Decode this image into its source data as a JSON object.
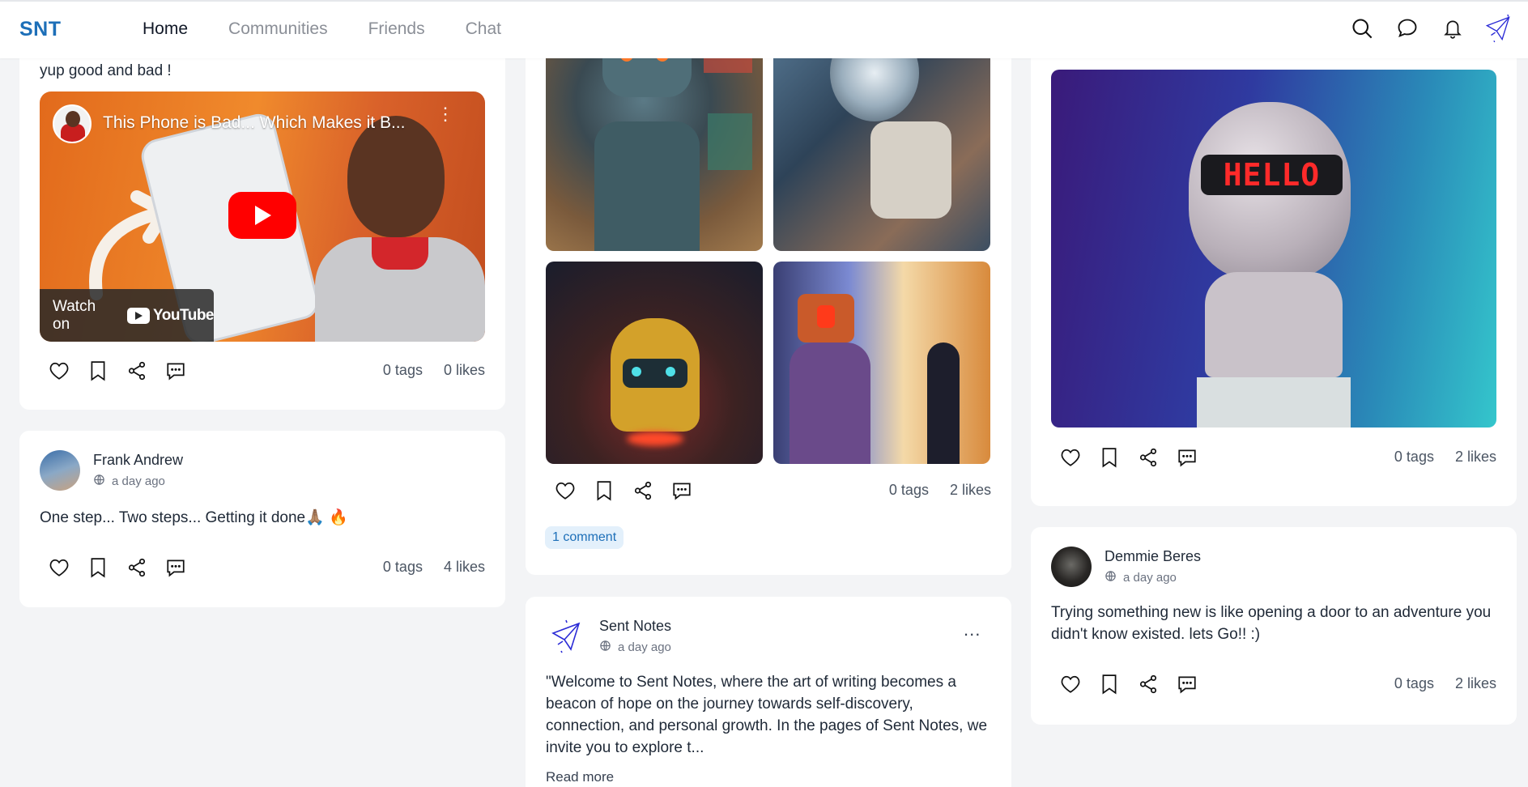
{
  "nav": {
    "logo": "SNT",
    "links": [
      {
        "label": "Home",
        "active": true
      },
      {
        "label": "Communities",
        "active": false
      },
      {
        "label": "Friends",
        "active": false
      },
      {
        "label": "Chat",
        "active": false
      }
    ],
    "icons": [
      "search-icon",
      "chat-bubble-icon",
      "bell-icon",
      "paper-plane-avatar-icon"
    ]
  },
  "posts": {
    "p1": {
      "text": "yup good and bad !",
      "video": {
        "title": "This Phone is Bad... Which Makes it B...",
        "watch_on": "Watch on",
        "platform": "YouTube"
      },
      "tags": "0 tags",
      "likes": "0 likes"
    },
    "p2": {
      "author": "Frank Andrew",
      "time": "a day ago",
      "text": "One step... Two steps... Getting it done🙏🏽 🔥",
      "tags": "0 tags",
      "likes": "4 likes"
    },
    "p3": {
      "tags": "0 tags",
      "likes": "2 likes",
      "comments": "1 comment"
    },
    "p4": {
      "author": "Sent Notes",
      "time": "a day ago",
      "text": "\"Welcome to Sent Notes, where the art of writing becomes a beacon of hope on the journey towards self-discovery, connection, and personal growth. In the pages of Sent Notes, we invite you to explore t...",
      "read_more": "Read more",
      "menu": "..."
    },
    "p5": {
      "image_text": "HELLO",
      "tags": "0 tags",
      "likes": "2 likes"
    },
    "p6": {
      "author": "Demmie Beres",
      "time": "a day ago",
      "text": "Trying something new is like opening a door to an adventure you didn't know existed.  lets Go!! :)",
      "tags": "0 tags",
      "likes": "2 likes"
    }
  },
  "colors": {
    "brand": "#1d6fb8",
    "comment_pill_bg": "#e3f0fb",
    "page_bg": "#f3f4f6"
  }
}
